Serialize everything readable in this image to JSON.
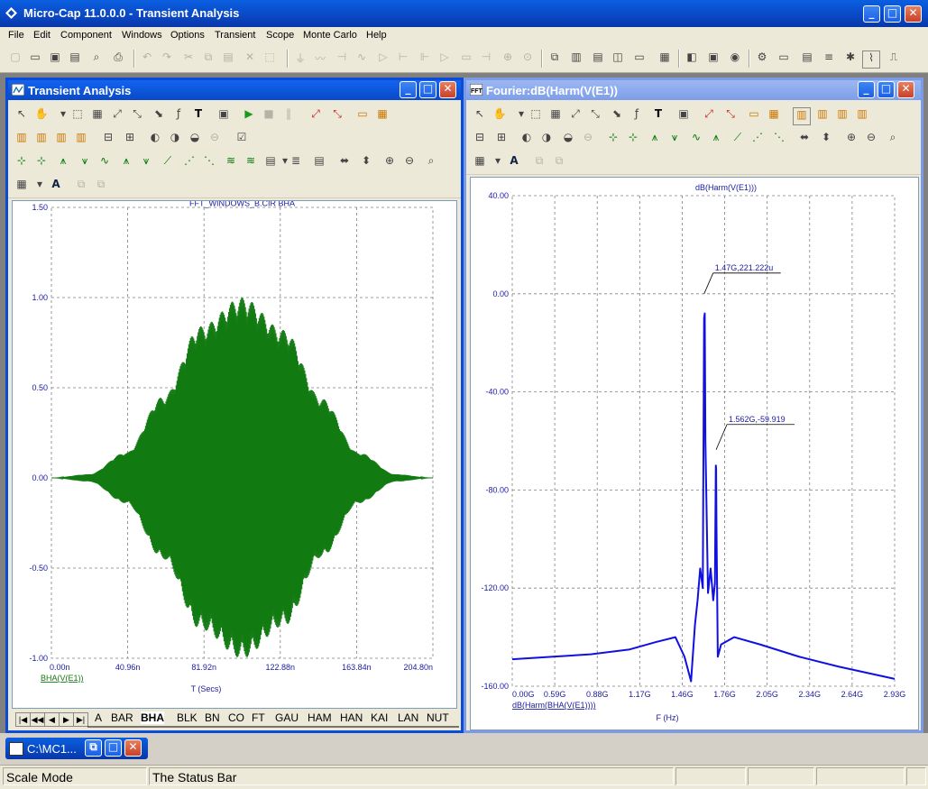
{
  "app": {
    "title": "Micro-Cap 11.0.0.0 - Transient Analysis",
    "menu": [
      "File",
      "Edit",
      "Component",
      "Windows",
      "Options",
      "Transient",
      "Scope",
      "Monte Carlo",
      "Help"
    ]
  },
  "transient_window": {
    "title": "Transient Analysis",
    "tabs": [
      "A",
      "BAR",
      "BHA",
      "BLK",
      "BN",
      "CO",
      "FT",
      "GAU",
      "HAM",
      "HAN",
      "KAI",
      "LAN",
      "NUT"
    ],
    "active_tab": "BHA"
  },
  "fourier_window": {
    "title": "Fourier:dB(Harm(V(E1))"
  },
  "minimized_window": {
    "title": "C:\\MC1..."
  },
  "status": {
    "mode": "Scale Mode",
    "message": "The Status Bar"
  },
  "chart_data": [
    {
      "type": "line",
      "title": "FFT_WINDOWS_B.CIR BHA",
      "xlabel": "T (Secs)",
      "series_label": "BHA(V(E1))",
      "x_ticks": [
        "0.00n",
        "40.96n",
        "81.92n",
        "122.88n",
        "163.84n",
        "204.80n"
      ],
      "y_ticks": [
        "1.50",
        "1.00",
        "0.50",
        "0.00",
        "-0.50",
        "-1.00"
      ],
      "xlim": [
        0,
        204.8
      ],
      "ylim": [
        -1.0,
        1.5
      ],
      "grid": true,
      "color": "#117a11",
      "envelope": {
        "x": [
          0,
          20,
          40,
          60,
          80,
          102.4,
          125,
          145,
          165,
          185,
          204.8
        ],
        "upper": [
          0.0,
          0.02,
          0.14,
          0.45,
          0.84,
          1.0,
          0.82,
          0.44,
          0.14,
          0.02,
          0.0
        ]
      }
    },
    {
      "type": "line",
      "title": "dB(Harm(V(E1)))",
      "xlabel": "F (Hz)",
      "series_label": "dB(Harm(BHA(V(E1))))",
      "x_ticks": [
        "0.00G",
        "0.59G",
        "0.88G",
        "1.17G",
        "1.46G",
        "1.76G",
        "2.05G",
        "2.34G",
        "2.64G",
        "2.93G"
      ],
      "y_ticks": [
        "40.00",
        "0.00",
        "-40.00",
        "-80.00",
        "-120.00",
        "-160.00"
      ],
      "xlim": [
        0,
        2.93
      ],
      "ylim": [
        -160,
        40
      ],
      "grid": true,
      "color": "#1010e0",
      "x": [
        0.0,
        0.3,
        0.6,
        0.9,
        1.1,
        1.25,
        1.32,
        1.37,
        1.4,
        1.42,
        1.44,
        1.46,
        1.47,
        1.475,
        1.48,
        1.5,
        1.52,
        1.54,
        1.553,
        1.56,
        1.562,
        1.565,
        1.575,
        1.6,
        1.7,
        1.9,
        2.2,
        2.5,
        2.93
      ],
      "y": [
        -149,
        -148,
        -147,
        -145,
        -142,
        -140,
        -148,
        -158,
        -135,
        -125,
        -112,
        -120,
        -10,
        -8,
        -60,
        -122,
        -112,
        -125,
        -118,
        -70,
        -71,
        -95,
        -148,
        -143,
        -140,
        -143,
        -148,
        -152,
        -157
      ],
      "annotations": [
        {
          "label": "1.47G,221.222u",
          "x": 1.47,
          "y": 0.0
        },
        {
          "label": "1.562G,-59.919",
          "x": 1.562,
          "y": -59.919
        }
      ]
    }
  ]
}
